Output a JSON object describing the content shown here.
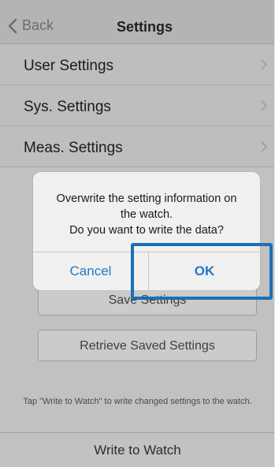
{
  "navbar": {
    "back_label": "Back",
    "title": "Settings"
  },
  "list": {
    "items": [
      {
        "label": "User Settings"
      },
      {
        "label": "Sys. Settings"
      },
      {
        "label": "Meas. Settings"
      }
    ]
  },
  "background_buttons": {
    "save_partial": "Save Settings",
    "retrieve": "Retrieve Saved Settings"
  },
  "hint": "Tap \"Write to Watch\" to write changed settings to the watch.",
  "footer": {
    "label": "Write to Watch"
  },
  "alert": {
    "message_line1": "Overwrite the setting information on",
    "message_line2": "the watch.",
    "message_line3": "Do you want to write the data?",
    "cancel_label": "Cancel",
    "ok_label": "OK"
  },
  "colors": {
    "accent": "#1f78c8",
    "highlight": "#1a6fb8"
  },
  "icons": {
    "back": "chevron-left-icon",
    "row": "chevron-right-icon"
  }
}
